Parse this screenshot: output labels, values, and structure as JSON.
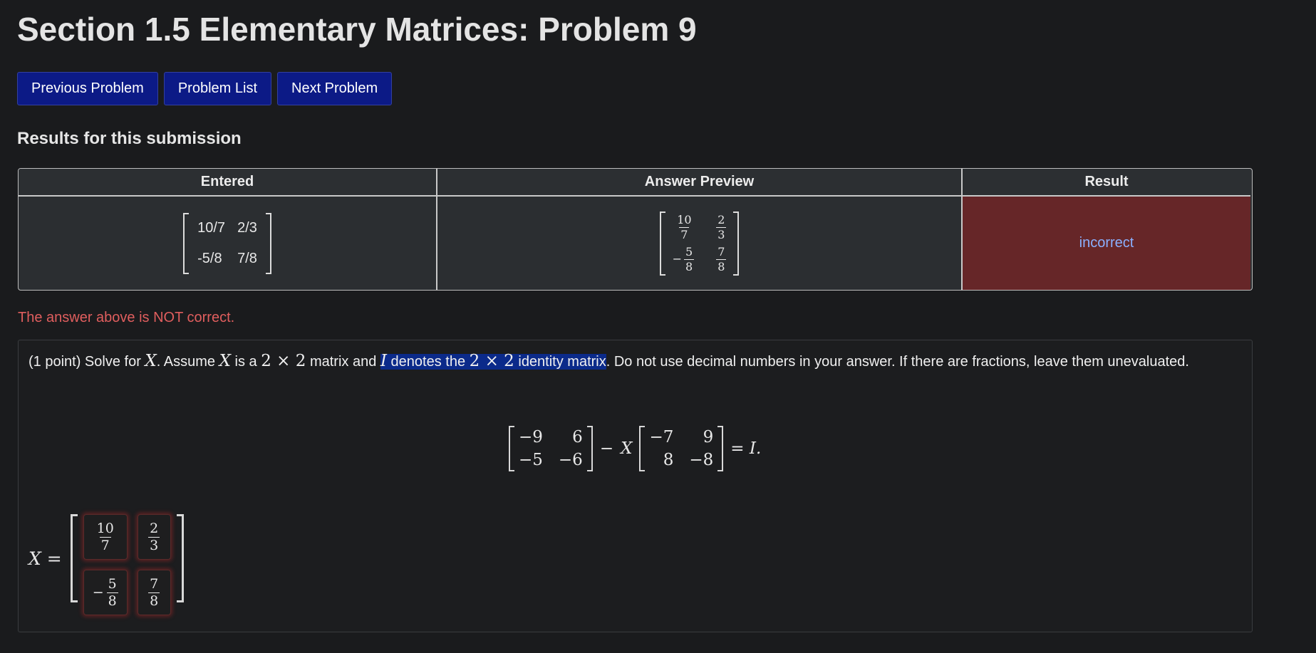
{
  "page": {
    "title": "Section 1.5 Elementary Matrices: Problem 9"
  },
  "nav": {
    "previous": "Previous Problem",
    "list": "Problem List",
    "next": "Next Problem"
  },
  "results": {
    "heading": "Results for this submission",
    "columns": [
      "Entered",
      "Answer Preview",
      "Result"
    ],
    "entered": [
      [
        "10/7",
        "2/3"
      ],
      [
        "-5/8",
        "7/8"
      ]
    ],
    "preview": [
      {
        "sign": "",
        "num": "10",
        "den": "7"
      },
      {
        "sign": "",
        "num": "2",
        "den": "3"
      },
      {
        "sign": "−",
        "num": "5",
        "den": "8"
      },
      {
        "sign": "",
        "num": "7",
        "den": "8"
      }
    ],
    "result": "incorrect",
    "result_bg": "#662628"
  },
  "warning": "The answer above is NOT correct.",
  "problem": {
    "points": "(1 point) Solve for ",
    "var_x": "X",
    "t1": ". Assume ",
    "t2": " is a ",
    "dim": "2 × 2",
    "t3": " matrix and ",
    "var_i": "I",
    "t4": " denotes the ",
    "t5": " identity matrix",
    "t6": ". Do not use decimal numbers in your answer. If there are fractions, leave them unevaluated.",
    "equation": {
      "A": [
        [
          "−9",
          "6"
        ],
        [
          "−5",
          "−6"
        ]
      ],
      "minus": "−",
      "X": "X",
      "B": [
        [
          "−7",
          "9"
        ],
        [
          "8",
          "−8"
        ]
      ],
      "rhs": "= I."
    },
    "answer": {
      "label": "X =",
      "cells": [
        {
          "sign": "",
          "num": "10",
          "den": "7"
        },
        {
          "sign": "",
          "num": "2",
          "den": "3"
        },
        {
          "sign": "−",
          "num": "5",
          "den": "8"
        },
        {
          "sign": "",
          "num": "7",
          "den": "8"
        }
      ]
    }
  },
  "colors": {
    "background": "#1a1b1d",
    "nav_button": "#0c1a86",
    "warning": "#e05e5e",
    "link": "#8ab0ff"
  }
}
